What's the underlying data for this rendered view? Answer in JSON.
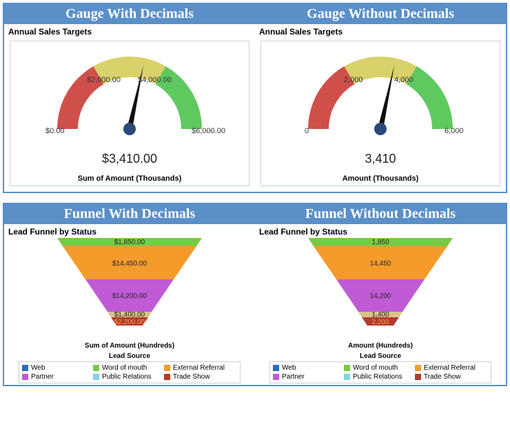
{
  "gauge_section": {
    "left": {
      "title": "Gauge With Decimals",
      "subtitle": "Annual Sales Targets",
      "value_label": "$3,410.00",
      "axis_label": "Sum of Amount (Thousands)",
      "ticks": {
        "t0": "$0.00",
        "t1": "$2,000.00",
        "t2": "$4,000.00",
        "t3": "$6,000.00"
      }
    },
    "right": {
      "title": "Gauge Without Decimals",
      "subtitle": "Annual Sales Targets",
      "value_label": "3,410",
      "axis_label": "Amount (Thousands)",
      "ticks": {
        "t0": "0",
        "t1": "2,000",
        "t2": "4,000",
        "t3": "6,000"
      }
    }
  },
  "funnel_section": {
    "left": {
      "title": "Funnel With Decimals",
      "subtitle": "Lead Funnel by Status",
      "axis_label": "Sum of Amount (Hundreds)",
      "legend_title": "Lead Source",
      "values": {
        "v0": "$1,850.00",
        "v1": "$14,450.00",
        "v2": "$14,200.00",
        "v3": "$1,400.00",
        "v4": "$2,200.00"
      }
    },
    "right": {
      "title": "Funnel Without Decimals",
      "subtitle": "Lead Funnel by Status",
      "axis_label": "Amount (Hundreds)",
      "legend_title": "Lead Source",
      "values": {
        "v0": "1,850",
        "v1": "14,450",
        "v2": "14,200",
        "v3": "1,400",
        "v4": "2,200"
      }
    },
    "legend": {
      "l0": "Web",
      "l1": "Word of mouth",
      "l2": "External Referral",
      "l3": "Partner",
      "l4": "Public Relations",
      "l5": "Trade Show"
    }
  },
  "colors": {
    "red": "#cf4f4b",
    "yellow": "#d9d16a",
    "green": "#5fc85f",
    "green2": "#7ac943",
    "orange": "#f59b2c",
    "purple": "#c05bd6",
    "tan": "#d8c38a",
    "darkred": "#b43a2e",
    "blue": "#2a6bc2",
    "cyan": "#7fd6e0"
  },
  "chart_data": [
    {
      "type": "gauge",
      "title": "Annual Sales Targets (with decimals)",
      "value": 3410,
      "min": 0,
      "max": 6000,
      "bands": [
        {
          "from": 0,
          "to": 2000,
          "color": "red"
        },
        {
          "from": 2000,
          "to": 4000,
          "color": "yellow"
        },
        {
          "from": 4000,
          "to": 6000,
          "color": "green"
        }
      ],
      "unit": "Thousands",
      "format": "$#,##0.00"
    },
    {
      "type": "gauge",
      "title": "Annual Sales Targets (no decimals)",
      "value": 3410,
      "min": 0,
      "max": 6000,
      "bands": [
        {
          "from": 0,
          "to": 2000,
          "color": "red"
        },
        {
          "from": 2000,
          "to": 4000,
          "color": "yellow"
        },
        {
          "from": 4000,
          "to": 6000,
          "color": "green"
        }
      ],
      "unit": "Thousands",
      "format": "#,##0"
    },
    {
      "type": "funnel",
      "title": "Lead Funnel by Status (with decimals)",
      "categories": [
        "Word of mouth",
        "External Referral",
        "Partner",
        "Public Relations",
        "Trade Show"
      ],
      "values": [
        1850,
        14450,
        14200,
        1400,
        2200
      ],
      "unit": "Hundreds",
      "format": "$#,##0.00",
      "legend_items": [
        "Web",
        "Word of mouth",
        "External Referral",
        "Partner",
        "Public Relations",
        "Trade Show"
      ]
    },
    {
      "type": "funnel",
      "title": "Lead Funnel by Status (no decimals)",
      "categories": [
        "Word of mouth",
        "External Referral",
        "Partner",
        "Public Relations",
        "Trade Show"
      ],
      "values": [
        1850,
        14450,
        14200,
        1400,
        2200
      ],
      "unit": "Hundreds",
      "format": "#,##0",
      "legend_items": [
        "Web",
        "Word of mouth",
        "External Referral",
        "Partner",
        "Public Relations",
        "Trade Show"
      ]
    }
  ]
}
